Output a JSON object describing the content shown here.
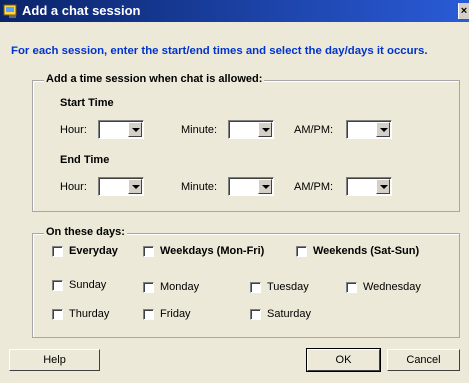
{
  "window": {
    "title": "Add a chat session",
    "close_glyph": "×"
  },
  "instructions": "For each session, enter the start/end times and select the day/days it occurs.",
  "time_group": {
    "legend": "Add a time session when chat is allowed:",
    "start": {
      "heading": "Start Time",
      "hour_label": "Hour:",
      "minute_label": "Minute:",
      "ampm_label": "AM/PM:",
      "hour_value": "",
      "minute_value": "",
      "ampm_value": ""
    },
    "end": {
      "heading": "End Time",
      "hour_label": "Hour:",
      "minute_label": "Minute:",
      "ampm_label": "AM/PM:",
      "hour_value": "",
      "minute_value": "",
      "ampm_value": ""
    }
  },
  "days_group": {
    "legend": "On these days:",
    "presets": [
      {
        "label": "Everyday",
        "checked": false
      },
      {
        "label": "Weekdays (Mon-Fri)",
        "checked": false
      },
      {
        "label": "Weekends (Sat-Sun)",
        "checked": false
      }
    ],
    "days": [
      {
        "label": "Sunday",
        "checked": false
      },
      {
        "label": "Monday",
        "checked": false
      },
      {
        "label": "Tuesday",
        "checked": false
      },
      {
        "label": "Wednesday",
        "checked": false
      },
      {
        "label": "Thurday",
        "checked": false
      },
      {
        "label": "Friday",
        "checked": false
      },
      {
        "label": "Saturday",
        "checked": false
      }
    ]
  },
  "buttons": {
    "help": "Help",
    "ok": "OK",
    "cancel": "Cancel"
  },
  "icons": {
    "title_icon": "chat-window-icon",
    "dropdown": "chevron-down-icon"
  },
  "colors": {
    "titlebar": "#0a246a",
    "instructions": "#0033cc",
    "dialog_bg": "#ece9d8"
  }
}
